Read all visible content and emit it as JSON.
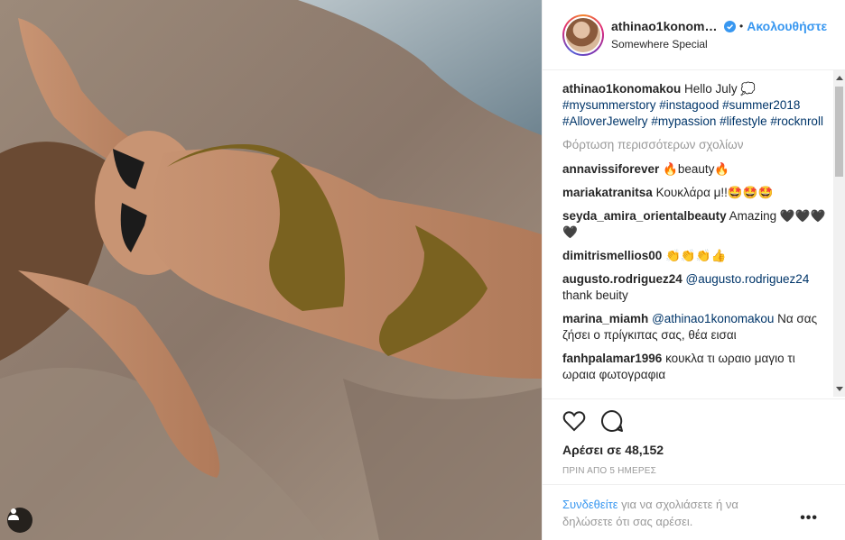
{
  "post": {
    "username": "athinao1konoma...",
    "follow_label": "Ακολουθήστε",
    "location": "Somewhere Special",
    "caption": {
      "user": "athinao1konomakou",
      "text": "Hello July 💭",
      "hashtags": [
        "#mysummerstory",
        "#instagood",
        "#summer2018",
        "#AlloverJewelry",
        "#mypassion",
        "#lifestyle",
        "#rocknroll"
      ]
    },
    "load_more_label": "Φόρτωση περισσότερων σχολίων",
    "comments": [
      {
        "user": "annavissiforever",
        "text": "🔥beauty🔥"
      },
      {
        "user": "mariakatranitsa",
        "text": "Κουκλάρα μ!!🤩🤩🤩"
      },
      {
        "user": "seyda_amira_orientalbeauty",
        "text": "Amazing 🖤🖤🖤🖤"
      },
      {
        "user": "dimitrismellios00",
        "text": "👏👏👏👍"
      },
      {
        "user": "augusto.rodriguez24",
        "mention": "@augusto.rodriguez24",
        "text": "thank beuity"
      },
      {
        "user": "marina_miamh",
        "mention": "@athinao1konomakou",
        "text": "Να σας ζήσει ο πρίγκιπας σας, θέα εισαι"
      },
      {
        "user": "fanhpalamar1996",
        "text": "κουκλα τι ωραιο μαγιο τι ωραια φωτογραφια"
      }
    ],
    "likes_label": "Αρέσει σε 48,152",
    "time_label": "ΠΡΙΝ ΑΠΟ 5 ΗΜΕΡΕΣ",
    "login_link": "Συνδεθείτε",
    "login_text": "για να σχολιάσετε ή να δηλώσετε ότι σας αρέσει.",
    "more_label": "•••"
  },
  "icons": {
    "verified": "verified-badge-icon",
    "like": "heart-icon",
    "comment": "comment-bubble-icon",
    "tagged_user": "person-icon"
  },
  "colors": {
    "link": "#3897f0",
    "hashtag": "#003569",
    "muted": "#999999"
  }
}
